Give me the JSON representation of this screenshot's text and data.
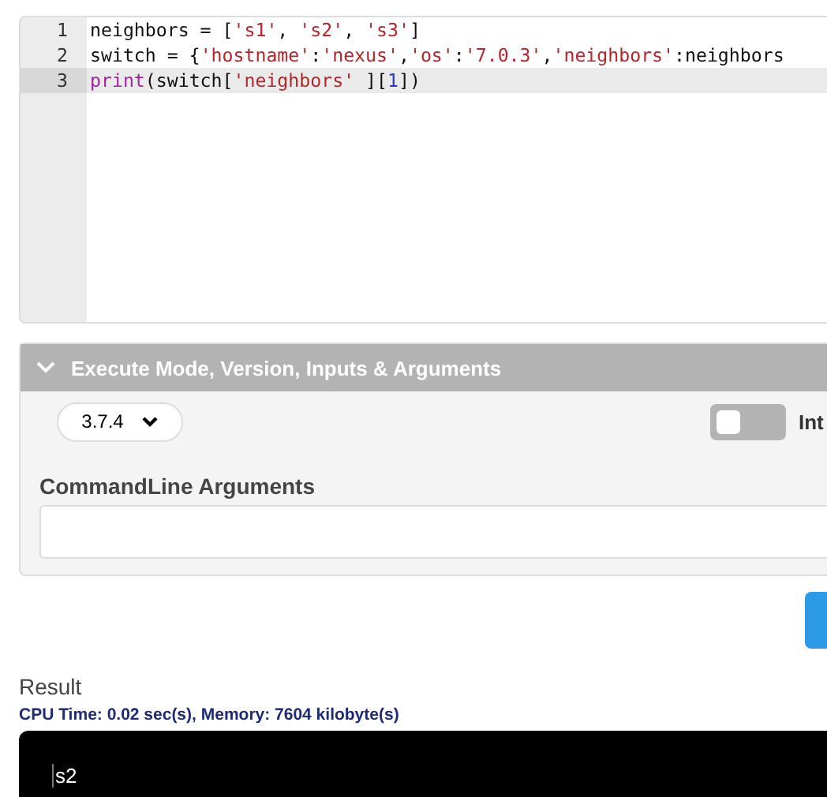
{
  "editor": {
    "lines": [
      {
        "number": "1",
        "active": false,
        "tokens": [
          {
            "kind": "plain",
            "text": "neighbors = ["
          },
          {
            "kind": "str",
            "text": "'s1'"
          },
          {
            "kind": "plain",
            "text": ", "
          },
          {
            "kind": "str",
            "text": "'s2'"
          },
          {
            "kind": "plain",
            "text": ", "
          },
          {
            "kind": "str",
            "text": "'s3'"
          },
          {
            "kind": "plain",
            "text": "]"
          }
        ]
      },
      {
        "number": "2",
        "active": false,
        "tokens": [
          {
            "kind": "plain",
            "text": "switch = {"
          },
          {
            "kind": "str",
            "text": "'hostname'"
          },
          {
            "kind": "plain",
            "text": ":"
          },
          {
            "kind": "str",
            "text": "'nexus'"
          },
          {
            "kind": "plain",
            "text": ","
          },
          {
            "kind": "str",
            "text": "'os'"
          },
          {
            "kind": "plain",
            "text": ":"
          },
          {
            "kind": "str",
            "text": "'7.0.3'"
          },
          {
            "kind": "plain",
            "text": ","
          },
          {
            "kind": "str",
            "text": "'neighbors'"
          },
          {
            "kind": "plain",
            "text": ":neighbors"
          }
        ]
      },
      {
        "number": "3",
        "active": true,
        "tokens": [
          {
            "kind": "kw",
            "text": "print"
          },
          {
            "kind": "plain",
            "text": "(switch["
          },
          {
            "kind": "str",
            "text": "'neighbors'"
          },
          {
            "kind": "plain",
            "text": " ]["
          },
          {
            "kind": "num",
            "text": "1"
          },
          {
            "kind": "plain",
            "text": "])"
          }
        ]
      }
    ]
  },
  "options_panel": {
    "title": "Execute Mode, Version, Inputs & Arguments",
    "expanded": true,
    "version": "3.7.4",
    "toggle": {
      "label": "Int",
      "on": false
    },
    "arguments_label": "CommandLine Arguments"
  },
  "result": {
    "title": "Result",
    "stats": "CPU Time: 0.02 sec(s), Memory: 7604 kilobyte(s)",
    "output": "s2"
  }
}
